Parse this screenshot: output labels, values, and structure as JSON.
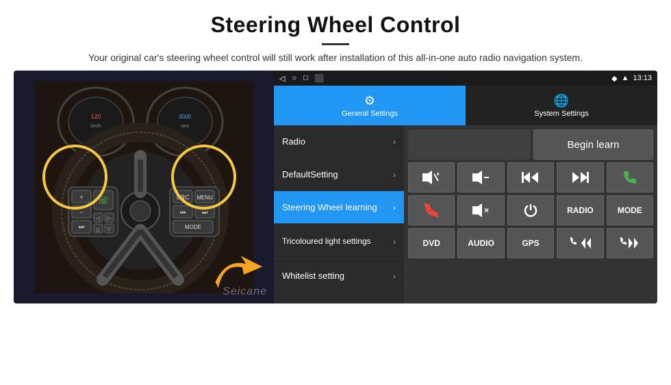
{
  "page": {
    "title": "Steering Wheel Control",
    "divider": true,
    "subtitle": "Your original car's steering wheel control will still work after installation of this all-in-one auto radio navigation system."
  },
  "status_bar": {
    "back_icon": "◁",
    "home_icon": "○",
    "recent_icon": "□",
    "screenshot_icon": "⬛",
    "location_icon": "◆",
    "signal_icon": "▲",
    "time": "13:13"
  },
  "nav_tabs": [
    {
      "id": "general",
      "icon": "⚙",
      "label": "General Settings",
      "active": true
    },
    {
      "id": "system",
      "icon": "🌐",
      "label": "System Settings",
      "active": false
    }
  ],
  "menu_items": [
    {
      "id": "radio",
      "label": "Radio",
      "active": false
    },
    {
      "id": "default",
      "label": "DefaultSetting",
      "active": false
    },
    {
      "id": "steering",
      "label": "Steering Wheel learning",
      "active": true
    },
    {
      "id": "tricolour",
      "label": "Tricoloured light settings",
      "active": false,
      "multiline": true
    },
    {
      "id": "whitelist",
      "label": "Whitelist setting",
      "active": false
    }
  ],
  "right_panel": {
    "begin_learn_label": "Begin learn",
    "buttons": [
      [
        {
          "id": "vol_up",
          "symbol": "◀+",
          "label": "vol-up"
        },
        {
          "id": "vol_down",
          "symbol": "◀−",
          "label": "vol-down"
        },
        {
          "id": "prev",
          "symbol": "⏮",
          "label": "previous"
        },
        {
          "id": "next",
          "symbol": "⏭",
          "label": "next"
        },
        {
          "id": "phone",
          "symbol": "☏",
          "label": "phone"
        }
      ],
      [
        {
          "id": "hangup",
          "symbol": "↩",
          "label": "hangup"
        },
        {
          "id": "mute",
          "symbol": "◀×",
          "label": "mute"
        },
        {
          "id": "power",
          "symbol": "⏻",
          "label": "power"
        },
        {
          "id": "radio_btn",
          "symbol": "RADIO",
          "label": "radio"
        },
        {
          "id": "mode",
          "symbol": "MODE",
          "label": "mode"
        }
      ],
      [
        {
          "id": "dvd",
          "symbol": "DVD",
          "label": "dvd"
        },
        {
          "id": "audio",
          "symbol": "AUDIO",
          "label": "audio"
        },
        {
          "id": "gps",
          "symbol": "GPS",
          "label": "gps"
        },
        {
          "id": "phone2",
          "symbol": "☏⏮",
          "label": "phone-prev"
        },
        {
          "id": "phone3",
          "symbol": "☏⏭",
          "label": "phone-next"
        }
      ]
    ]
  },
  "watermark": "Seicane"
}
